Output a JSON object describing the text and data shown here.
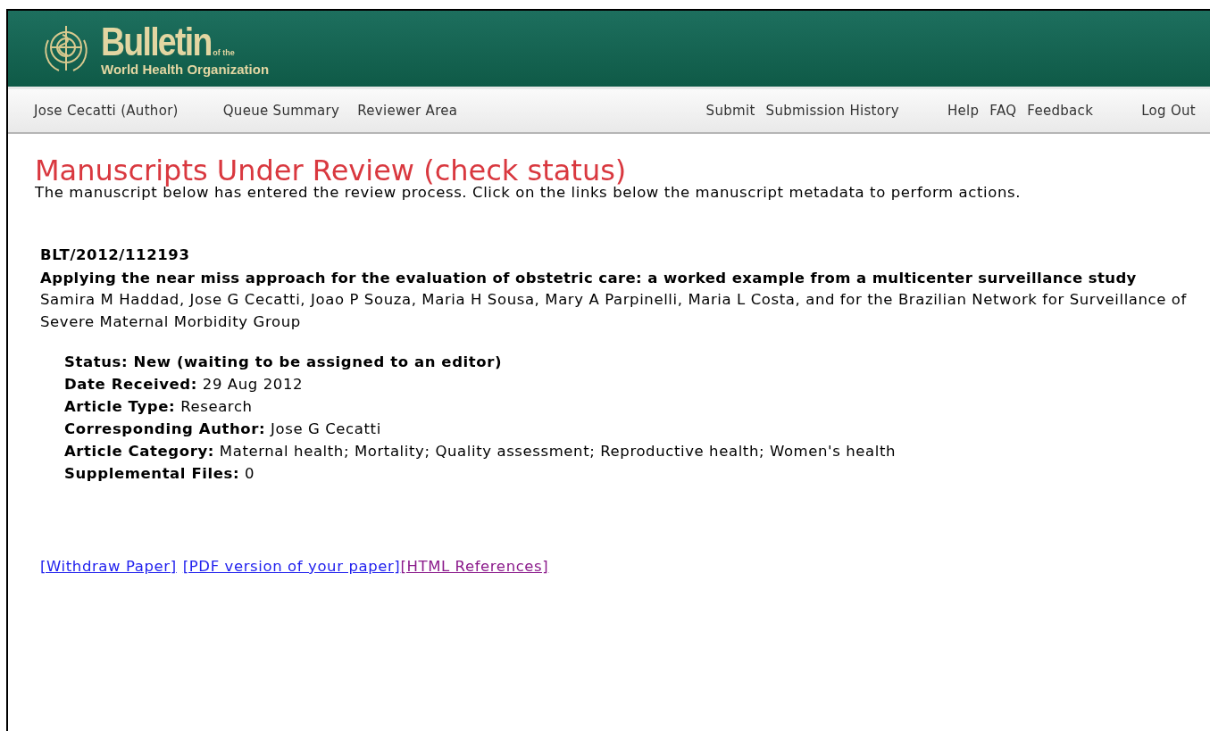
{
  "header": {
    "logo": {
      "title": "Bulletin",
      "small": "of the",
      "subtitle": "World Health Organization"
    }
  },
  "nav": {
    "left": [
      [
        {
          "label": "Jose Cecatti (Author)"
        }
      ],
      [
        {
          "label": "Queue Summary"
        },
        {
          "label": "Reviewer Area"
        }
      ]
    ],
    "right": [
      [
        {
          "label": "Submit"
        },
        {
          "label": "Submission History"
        }
      ],
      [
        {
          "label": "Help"
        },
        {
          "label": "FAQ"
        },
        {
          "label": "Feedback"
        }
      ],
      [
        {
          "label": "Log Out"
        }
      ]
    ]
  },
  "page_title": "Manuscripts Under Review (check status)",
  "intro": "The manuscript below has entered the review process. Click on the links below the manuscript metadata to perform actions.",
  "manuscript": {
    "id": "BLT/2012/112193",
    "title": "Applying the near miss approach for the evaluation of obstetric care: a worked example from a multicenter surveillance study",
    "authors": "Samira M Haddad, Jose G Cecatti, Joao P Souza, Maria H Sousa, Mary A Parpinelli, Maria L Costa, and for the Brazilian Network for Surveillance of Severe Maternal Morbidity Group",
    "fields": [
      {
        "kind": "status",
        "label": "Status:",
        "value": "New (waiting to be assigned to an editor)"
      },
      {
        "kind": "field",
        "label": "Date Received:",
        "value": "29 Aug 2012"
      },
      {
        "kind": "field",
        "label": "Article Type:",
        "value": "Research"
      },
      {
        "kind": "field",
        "label": "Corresponding Author:",
        "value": "Jose G Cecatti"
      },
      {
        "kind": "field",
        "label": "Article Category:",
        "value": "Maternal health; Mortality; Quality assessment; Reproductive health; Women's health"
      },
      {
        "kind": "field",
        "label": "Supplemental Files:",
        "value": "0"
      }
    ]
  },
  "links": [
    {
      "label": "[Withdraw Paper]",
      "visited": false
    },
    {
      "label": "[PDF version of your paper]",
      "visited": false
    },
    {
      "label": "[HTML References]",
      "visited": true
    }
  ]
}
